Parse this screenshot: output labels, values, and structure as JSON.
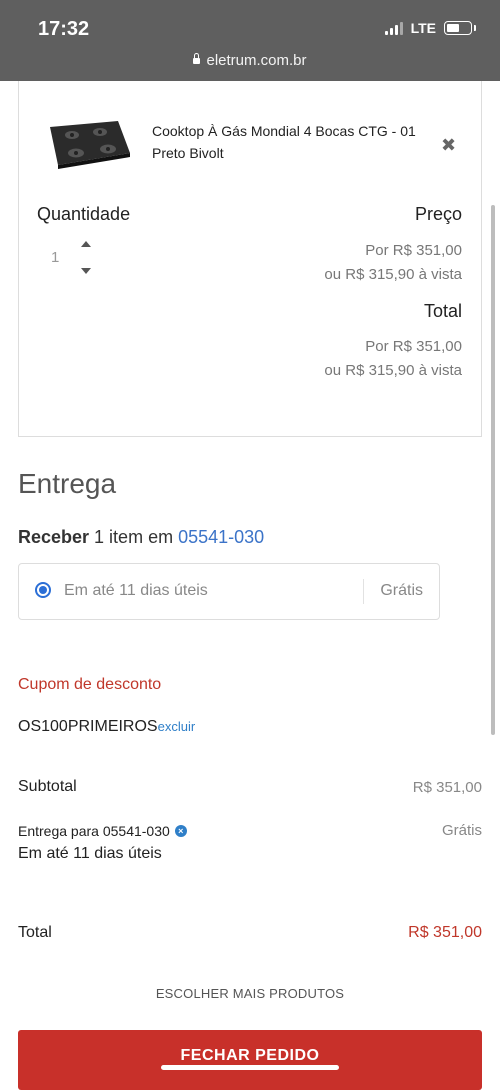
{
  "status_bar": {
    "time": "17:32",
    "network": "LTE"
  },
  "browser": {
    "url": "eletrum.com.br"
  },
  "cart": {
    "product_name": "Cooktop À Gás Mondial 4 Bocas CTG - 01 Preto Bivolt",
    "quantity_label": "Quantidade",
    "quantity": "1",
    "price_label": "Preço",
    "price_line": "Por R$ 351,00",
    "price_cash_line": "ou R$ 315,90 à vista",
    "total_label": "Total",
    "total_line": "Por R$ 351,00",
    "total_cash_line": "ou R$ 315,90 à vista"
  },
  "delivery": {
    "title": "Entrega",
    "receive_bold": "Receber",
    "receive_text": " 1 item em ",
    "zip": "05541-030",
    "option_label": "Em até 11 dias úteis",
    "option_price": "Grátis"
  },
  "coupon": {
    "title": "Cupom de desconto",
    "code": "OS100PRIMEIROS",
    "remove_label": "excluir"
  },
  "summary": {
    "subtotal_label": "Subtotal",
    "subtotal_value": "R$ 351,00",
    "delivery_to": "Entrega para 05541-030",
    "delivery_value": "Grátis",
    "delivery_time": "Em até 11 dias úteis",
    "total_label": "Total",
    "total_value": "R$ 351,00"
  },
  "actions": {
    "more_products": "ESCOLHER MAIS PRODUTOS",
    "checkout": "FECHAR PEDIDO"
  },
  "icons": {
    "lock": "lock-icon",
    "remove": "close-icon",
    "quantity_up": "chevron-up-icon",
    "quantity_down": "chevron-down-icon",
    "delivery_clear": "close-circle-icon"
  },
  "colors": {
    "accent_red": "#c8302a",
    "link_blue": "#3b73c8",
    "radio_blue": "#2c6fd6"
  }
}
